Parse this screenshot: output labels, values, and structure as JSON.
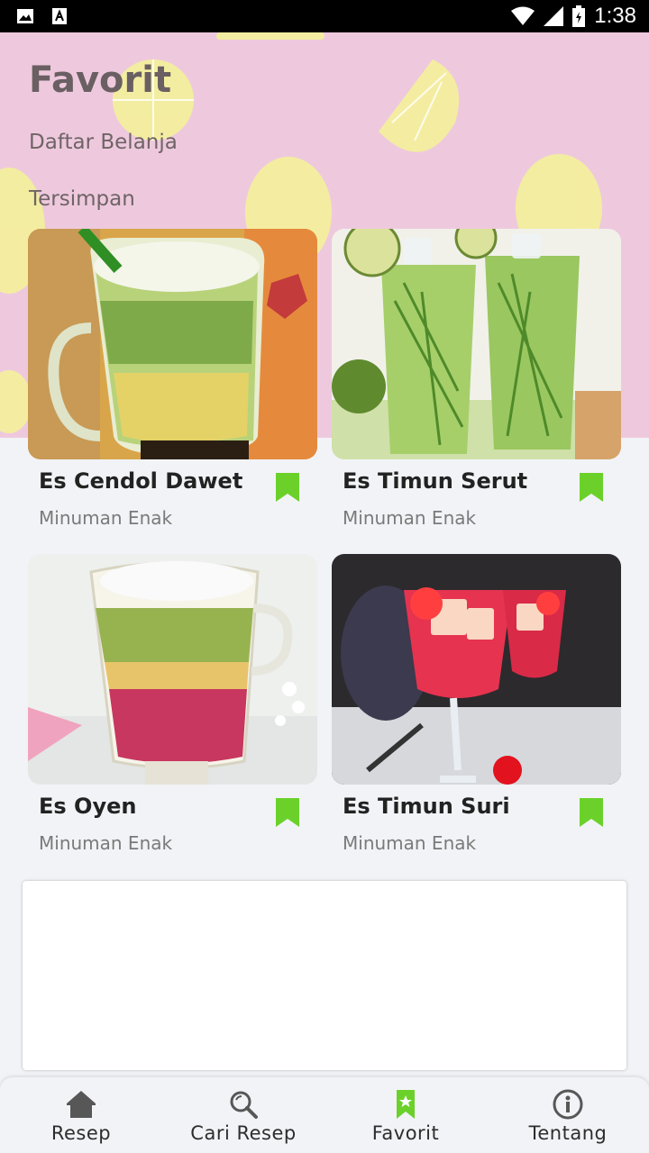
{
  "status_bar": {
    "time": "1:38",
    "icons": [
      "image-icon",
      "text-a-icon",
      "wifi-icon",
      "signal-icon",
      "battery-icon"
    ]
  },
  "header": {
    "title": "Favorit",
    "shopping_list": "Daftar Belanja",
    "saved": "Tersimpan",
    "background_color": "#eec9dd"
  },
  "cards": [
    {
      "title": "Es Cendol Dawet",
      "subtitle": "Minuman Enak",
      "bookmarked": true
    },
    {
      "title": "Es Timun Serut",
      "subtitle": "Minuman Enak",
      "bookmarked": true
    },
    {
      "title": "Es Oyen",
      "subtitle": "Minuman Enak",
      "bookmarked": true
    },
    {
      "title": "Es Timun Suri",
      "subtitle": "Minuman Enak",
      "bookmarked": true
    }
  ],
  "bottom_nav": {
    "items": [
      {
        "label": "Resep",
        "icon": "home-icon"
      },
      {
        "label": "Cari Resep",
        "icon": "search-icon"
      },
      {
        "label": "Favorit",
        "icon": "bookmark-star-icon"
      },
      {
        "label": "Tentang",
        "icon": "info-icon"
      }
    ],
    "active": "Favorit"
  },
  "colors": {
    "accent": "#6bd12a",
    "text_dark": "#222222",
    "text_muted": "#7a7a7a"
  }
}
